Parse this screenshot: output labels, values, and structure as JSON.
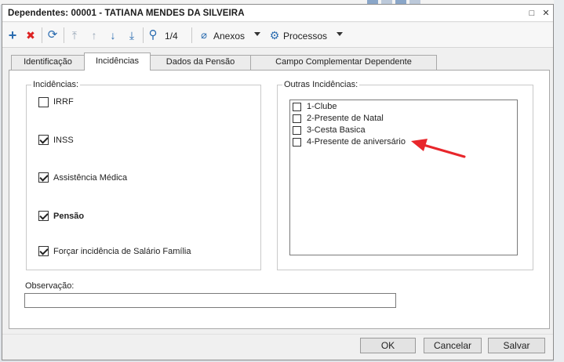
{
  "window": {
    "title": "Dependentes: 00001 - TATIANA MENDES DA SILVEIRA",
    "maximize_glyph": "□",
    "close_glyph": "✕"
  },
  "toolbar": {
    "add_glyph": "+",
    "delete_glyph": "✖",
    "refresh_glyph": "⟳",
    "first_glyph": "⤒",
    "prev_glyph": "↑",
    "next_glyph": "↓",
    "last_glyph": "⤓",
    "search_glyph": "⚲",
    "record_position": "1/4",
    "attach_glyph": "⌀",
    "anexos_label": "Anexos",
    "gear_glyph": "⚙",
    "processos_label": "Processos"
  },
  "tabs": [
    {
      "label": "Identificação",
      "active": false
    },
    {
      "label": "Incidências",
      "active": true
    },
    {
      "label": "Dados da Pensão",
      "active": false
    },
    {
      "label": "Campo Complementar Dependente",
      "active": false
    }
  ],
  "incidencias": {
    "legend": "Incidências:",
    "items": [
      {
        "label": "IRRF",
        "checked": false,
        "bold": false
      },
      {
        "label": "INSS",
        "checked": true,
        "bold": false
      },
      {
        "label": "Assistência Médica",
        "checked": true,
        "bold": false
      },
      {
        "label": "Pensão",
        "checked": true,
        "bold": true
      },
      {
        "label": "Forçar incidência de Salário Família",
        "checked": true,
        "bold": false
      }
    ]
  },
  "outras": {
    "legend": "Outras Incidências:",
    "items": [
      {
        "label": "1-Clube",
        "checked": false
      },
      {
        "label": "2-Presente de Natal",
        "checked": false
      },
      {
        "label": "3-Cesta Basica",
        "checked": false
      },
      {
        "label": "4-Presente de aniversário",
        "checked": false
      }
    ]
  },
  "observacao": {
    "label": "Observação:",
    "value": ""
  },
  "buttons": {
    "ok": "OK",
    "cancel": "Cancelar",
    "save": "Salvar"
  },
  "colors": {
    "accent_blue": "#2b6cb0",
    "delete_red": "#dd2222",
    "annotation_arrow": "#e8262b"
  }
}
